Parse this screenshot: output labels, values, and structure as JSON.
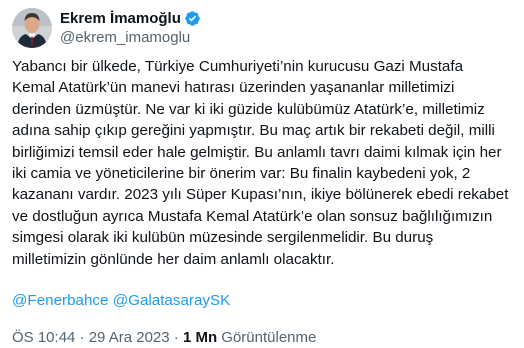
{
  "author": {
    "display_name": "Ekrem İmamoğlu",
    "handle": "@ekrem_imamoglu",
    "verified": true,
    "verified_badge_color": "#1d9bf0"
  },
  "tweet": {
    "text": "Yabancı bir ülkede, Türkiye Cumhuriyeti’nin kurucusu Gazi Mustafa\nKemal Atatürk’ün manevi hatırası üzerinden yaşananlar milletimizi\nderinden üzmüştür. Ne var ki iki güzide kulübümüz Atatürk’e, milletimiz\nadına sahip çıkıp gereğini yapmıştır. Bu maç artık bir rekabeti değil, milli\nbirliğimizi temsil eder hale gelmiştir. Bu anlamlı tavrı daimi kılmak için her\niki camia ve yöneticilerine bir önerim var: Bu finalin kaybedeni yok, 2\nkazananı vardır. 2023 yılı Süper Kupası’nın, ikiye bölünerek ebedi rekabet\nve dostluğun ayrıca Mustafa Kemal Atatürk’e olan sonsuz bağlılığımızın\nsimgesi olarak iki kulübün müzesinde sergilenmelidir. Bu duruş\nmilletimizin gönlünde her daim anlamlı olacaktır.",
    "mentions": [
      "@Fenerbahce",
      "@GalatasaraySK"
    ],
    "mention_color": "#1d9bf0"
  },
  "meta": {
    "timestamp": "ÖS 10:44 · 29 Ara 2023 · ",
    "views_count": "1 Mn",
    "views_label": " Görüntülenme"
  }
}
